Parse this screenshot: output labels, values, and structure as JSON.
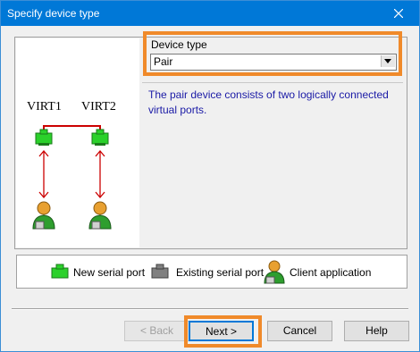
{
  "window": {
    "title": "Specify device type"
  },
  "diagram": {
    "virt1": "VIRT1",
    "virt2": "VIRT2"
  },
  "device_type": {
    "label": "Device type",
    "selected": "Pair"
  },
  "description": "The pair device consists of two logically connected virtual ports.",
  "legend": {
    "new_port": "New serial port",
    "existing_port": "Existing serial port",
    "client_app": "Client application"
  },
  "buttons": {
    "back": "< Back",
    "next": "Next >",
    "cancel": "Cancel",
    "help": "Help"
  },
  "colors": {
    "accent": "#0078d7",
    "highlight": "#f08a2a",
    "description_text": "#1a1aa6",
    "connector": "#cc0000"
  }
}
